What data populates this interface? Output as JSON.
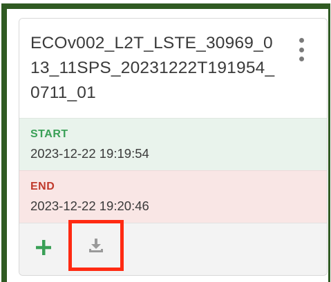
{
  "granule": {
    "title": "ECOv002_L2T_LSTE_30969_013_11SPS_20231222T191954_0711_01"
  },
  "start": {
    "label": "START",
    "value": "2023-12-22 19:19:54"
  },
  "end": {
    "label": "END",
    "value": "2023-12-22 19:20:46"
  },
  "icons": {
    "menu": "more-vertical-icon",
    "add": "plus-icon",
    "download": "download-icon"
  },
  "colors": {
    "frame": "#2f5a22",
    "start_label": "#3aa057",
    "start_bg": "#e9f3ec",
    "end_label": "#c0392b",
    "end_bg": "#f9e6e5",
    "add_icon": "#3aa057",
    "download_icon": "#9a9a9a",
    "highlight": "#ff2a12"
  }
}
